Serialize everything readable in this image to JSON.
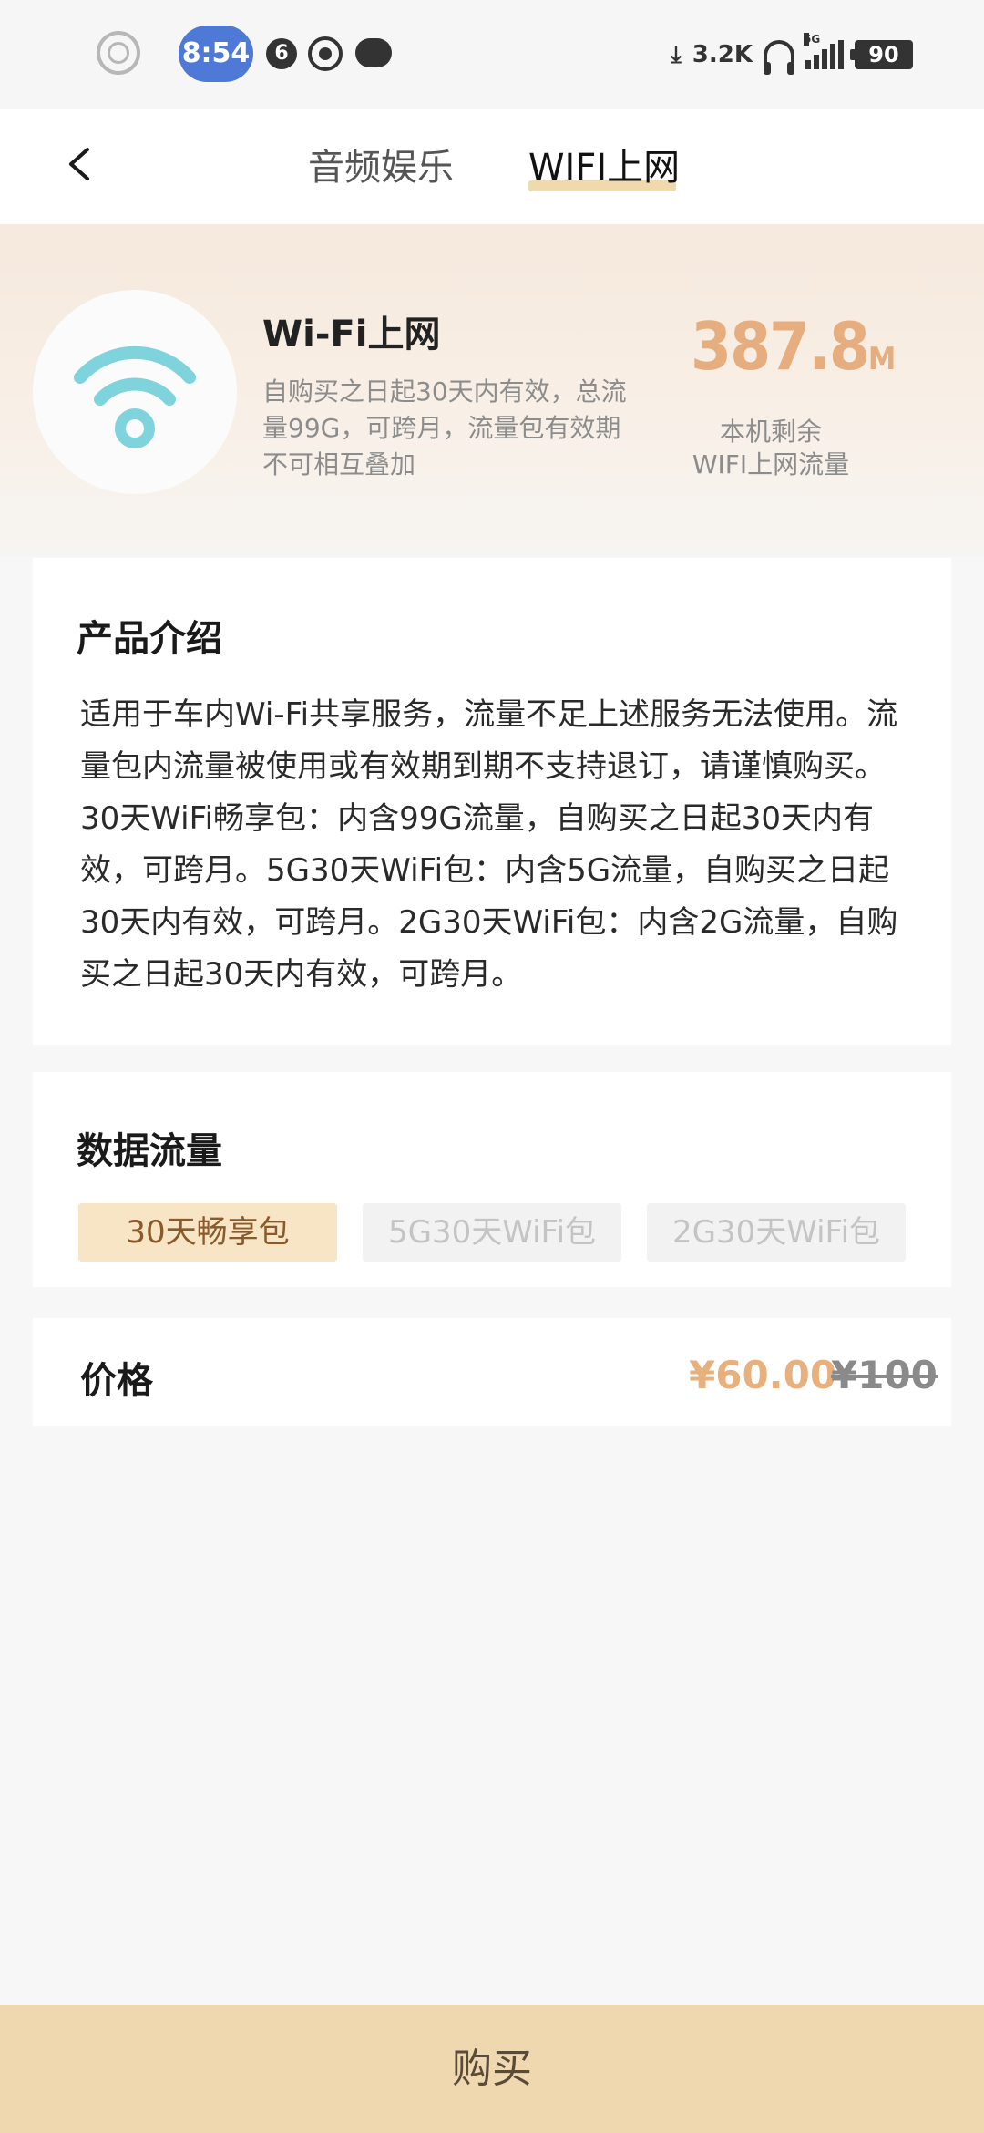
{
  "status_bar": {
    "time": "8:54",
    "notification_count": "6",
    "download_speed": "3.2K",
    "network": "5G",
    "battery": "90"
  },
  "nav": {
    "tabs": [
      {
        "label": "音频娱乐",
        "active": false
      },
      {
        "label": "WIFI上网",
        "active": true
      }
    ]
  },
  "hero": {
    "title": "Wi-Fi上网",
    "description": "自购买之日起30天内有效，总流量99G，可跨月，流量包有效期不可相互叠加",
    "remaining_value": "387.8",
    "remaining_unit": "M",
    "remaining_label_line1": "本机剩余",
    "remaining_label_line2": "WIFI上网流量"
  },
  "intro": {
    "title": "产品介绍",
    "text": "适用于车内Wi-Fi共享服务，流量不足上述服务无法使用。流量包内流量被使用或有效期到期不支持退订，请谨慎购买。30天WiFi畅享包：内含99G流量，自购买之日起30天内有效，可跨月。5G30天WiFi包：内含5G流量，自购买之日起30天内有效，可跨月。2G30天WiFi包：内含2G流量，自购买之日起30天内有效，可跨月。"
  },
  "data_plan": {
    "title": "数据流量",
    "packages": [
      {
        "label": "30天畅享包",
        "selected": true
      },
      {
        "label": "5G30天WiFi包",
        "selected": false
      },
      {
        "label": "2G30天WiFi包",
        "selected": false
      }
    ]
  },
  "price": {
    "label": "价格",
    "current": "¥60.00",
    "original": "¥100"
  },
  "buy_button": {
    "label": "购买"
  },
  "colors": {
    "accent": "#e8b07c",
    "buy_bar": "#efd8b0",
    "selected_pkg_bg": "#f7e5c6",
    "wifi_icon": "#7ed3dc"
  },
  "icons": {
    "back": "chevron-left-icon",
    "wifi": "wifi-icon"
  }
}
